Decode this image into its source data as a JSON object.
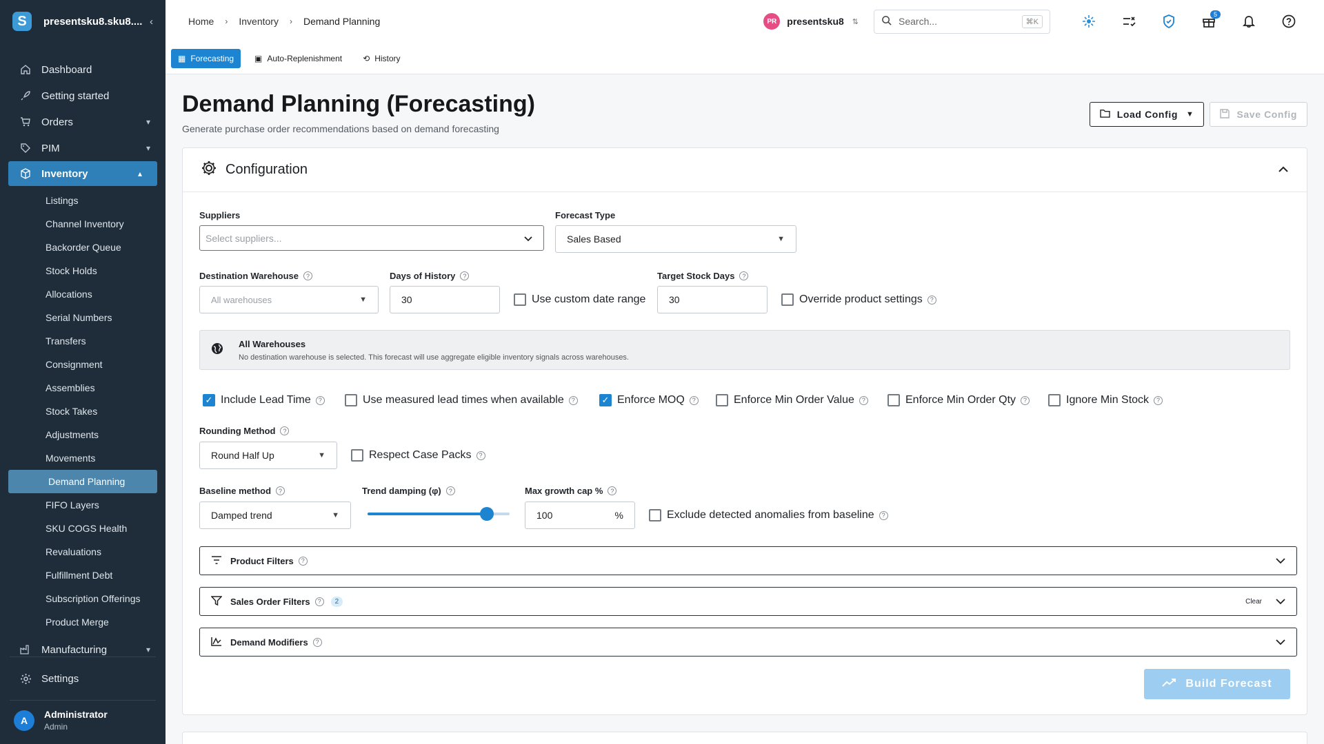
{
  "sidebar": {
    "org_name": "presentsku8.sku8....",
    "logo_letter": "S",
    "nav": [
      {
        "label": "Dashboard",
        "icon": "home-icon"
      },
      {
        "label": "Getting started",
        "icon": "rocket-icon"
      },
      {
        "label": "Orders",
        "icon": "cart-icon"
      },
      {
        "label": "PIM",
        "icon": "tag-icon"
      },
      {
        "label": "Inventory",
        "icon": "box-icon"
      }
    ],
    "inventory_items": [
      "Listings",
      "Channel Inventory",
      "Backorder Queue",
      "Stock Holds",
      "Allocations",
      "Serial Numbers",
      "Transfers",
      "Consignment",
      "Assemblies",
      "Stock Takes",
      "Adjustments",
      "Movements",
      "Demand Planning",
      "FIFO Layers",
      "SKU COGS Health",
      "Revaluations",
      "Fulfillment Debt",
      "Subscription Offerings",
      "Product Merge"
    ],
    "manufacturing": "Manufacturing",
    "settings": "Settings",
    "user": {
      "initial": "A",
      "name": "Administrator",
      "role": "Admin"
    }
  },
  "topbar": {
    "breadcrumbs": [
      "Home",
      "Inventory",
      "Demand Planning"
    ],
    "account_initials": "PR",
    "account_name": "presentsku8",
    "search_placeholder": "Search...",
    "search_shortcut": "⌘K",
    "gift_badge": "5"
  },
  "tabs": [
    {
      "label": "Forecasting",
      "icon": "▦"
    },
    {
      "label": "Auto-Replenishment",
      "icon": "▣"
    },
    {
      "label": "History",
      "icon": "⟲"
    }
  ],
  "page": {
    "title": "Demand Planning (Forecasting)",
    "subtitle": "Generate purchase order recommendations based on demand forecasting",
    "load_config": "Load Config",
    "save_config": "Save Config"
  },
  "config": {
    "title": "Configuration",
    "suppliers_label": "Suppliers",
    "suppliers_placeholder": "Select suppliers...",
    "forecast_type_label": "Forecast Type",
    "forecast_type_value": "Sales Based",
    "dest_wh_label": "Destination Warehouse",
    "dest_wh_placeholder": "All warehouses",
    "days_history_label": "Days of History",
    "days_history_value": "30",
    "custom_date_label": "Use custom date range",
    "target_stock_label": "Target Stock Days",
    "target_stock_value": "30",
    "override_label": "Override product settings",
    "info_title": "All Warehouses",
    "info_text": "No destination warehouse is selected. This forecast will use aggregate eligible inventory signals across warehouses.",
    "checks": [
      {
        "label": "Include Lead Time",
        "checked": true
      },
      {
        "label": "Use measured lead times when available",
        "checked": false
      },
      {
        "label": "Enforce MOQ",
        "checked": true
      },
      {
        "label": "Enforce Min Order Value",
        "checked": false
      },
      {
        "label": "Enforce Min Order Qty",
        "checked": false
      },
      {
        "label": "Ignore Min Stock",
        "checked": false
      }
    ],
    "rounding_label": "Rounding Method",
    "rounding_value": "Round Half Up",
    "case_packs_label": "Respect Case Packs",
    "baseline_label": "Baseline method",
    "baseline_value": "Damped trend",
    "trend_label": "Trend damping (φ)",
    "trend_level": 0.84,
    "growth_label": "Max growth cap %",
    "growth_value": "100",
    "growth_unit": "%",
    "exclude_label": "Exclude detected anomalies from baseline",
    "product_filters": "Product Filters",
    "sales_filters": "Sales Order Filters",
    "sales_filters_count": "2",
    "clear": "Clear",
    "demand_modifiers": "Demand Modifiers",
    "build": "Build Forecast"
  },
  "colors": {
    "accent": "#1c84d1",
    "sidebar": "#1f2d3a"
  }
}
